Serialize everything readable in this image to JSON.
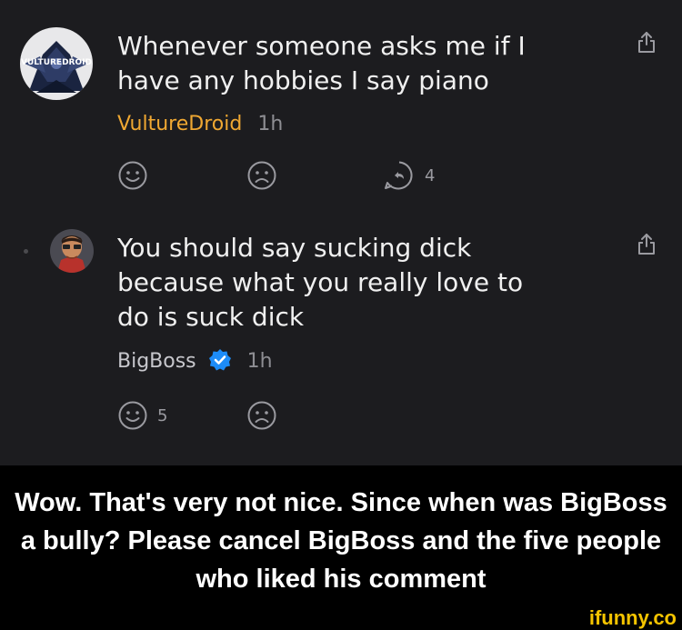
{
  "comments": [
    {
      "avatar_label": "VULTUREDROID",
      "text_lines": [
        "Whenever someone asks me if I",
        "have any hobbies I say piano"
      ],
      "username": "VultureDroid",
      "time": "1h",
      "replies_count": "4",
      "like_count": ""
    },
    {
      "text_lines": [
        "You should say sucking dick",
        "because what you really love to",
        "do is suck dick"
      ],
      "username": "BigBoss",
      "time": "1h",
      "like_count": "5"
    }
  ],
  "caption": {
    "text": "Wow. That's very not nice. Since when was BigBoss a bully? Please cancel BigBoss and the five people who liked his comment"
  },
  "watermark": "ifunny.co",
  "colors": {
    "background": "#1c1c1f",
    "username_accent": "#f0a832",
    "verified_badge": "#1d8cf8",
    "watermark": "#f5c400"
  }
}
